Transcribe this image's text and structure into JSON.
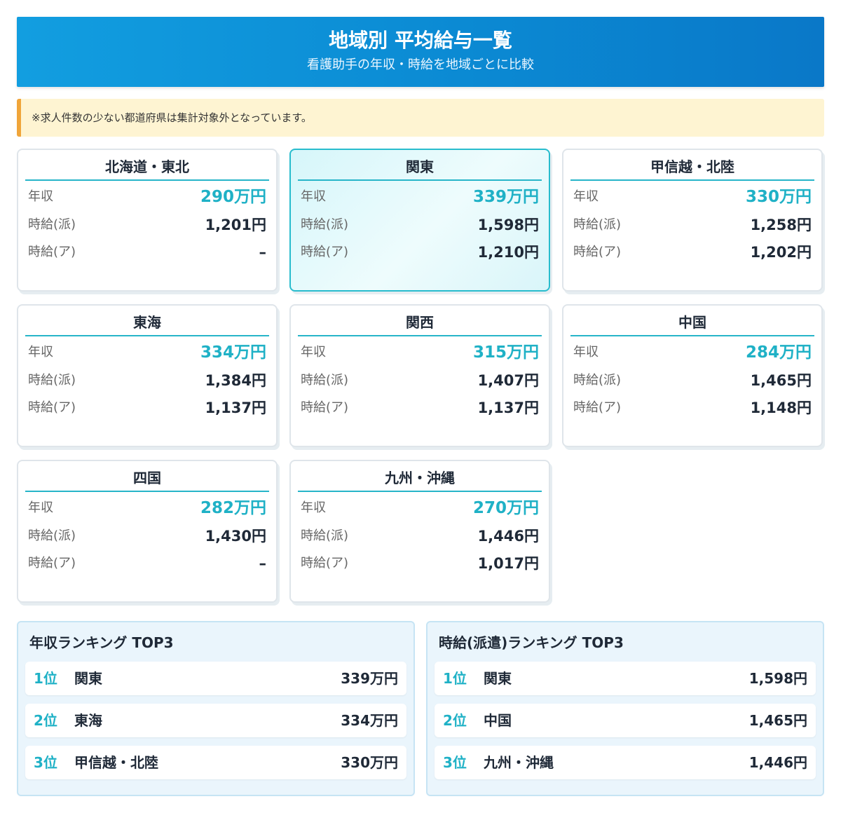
{
  "header": {
    "title": "地域別 平均給与一覧",
    "subtitle": "看護助手の年収・時給を地域ごとに比較"
  },
  "notice": "※求人件数の少ない都道府県は集計対象外となっています。",
  "labels": {
    "annual": "年収",
    "hourly_dispatch": "時給(派)",
    "hourly_parttime": "時給(ア)"
  },
  "regions": [
    {
      "name": "北海道・東北",
      "annual": "290万円",
      "hourly_dispatch": "1,201円",
      "hourly_parttime": "–",
      "highlight": false
    },
    {
      "name": "関東",
      "annual": "339万円",
      "hourly_dispatch": "1,598円",
      "hourly_parttime": "1,210円",
      "highlight": true
    },
    {
      "name": "甲信越・北陸",
      "annual": "330万円",
      "hourly_dispatch": "1,258円",
      "hourly_parttime": "1,202円",
      "highlight": false
    },
    {
      "name": "東海",
      "annual": "334万円",
      "hourly_dispatch": "1,384円",
      "hourly_parttime": "1,137円",
      "highlight": false
    },
    {
      "name": "関西",
      "annual": "315万円",
      "hourly_dispatch": "1,407円",
      "hourly_parttime": "1,137円",
      "highlight": false
    },
    {
      "name": "中国",
      "annual": "284万円",
      "hourly_dispatch": "1,465円",
      "hourly_parttime": "1,148円",
      "highlight": false
    },
    {
      "name": "四国",
      "annual": "282万円",
      "hourly_dispatch": "1,430円",
      "hourly_parttime": "–",
      "highlight": false
    },
    {
      "name": "九州・沖縄",
      "annual": "270万円",
      "hourly_dispatch": "1,446円",
      "hourly_parttime": "1,017円",
      "highlight": false
    }
  ],
  "rankings": [
    {
      "title": "年収ランキング TOP3",
      "items": [
        {
          "rank": "1位",
          "name": "関東",
          "value": "339万円"
        },
        {
          "rank": "2位",
          "name": "東海",
          "value": "334万円"
        },
        {
          "rank": "3位",
          "name": "甲信越・北陸",
          "value": "330万円"
        }
      ]
    },
    {
      "title": "時給(派遣)ランキング TOP3",
      "items": [
        {
          "rank": "1位",
          "name": "関東",
          "value": "1,598円"
        },
        {
          "rank": "2位",
          "name": "中国",
          "value": "1,465円"
        },
        {
          "rank": "3位",
          "name": "九州・沖縄",
          "value": "1,446円"
        }
      ]
    }
  ],
  "colors": {
    "header_start": "#129ee0",
    "header_end": "#0a78c8",
    "accent": "#1fb1c6",
    "notice_bg": "#fef4d2",
    "notice_border": "#f0a53a",
    "highlight_bg": "#d6f6fa"
  }
}
